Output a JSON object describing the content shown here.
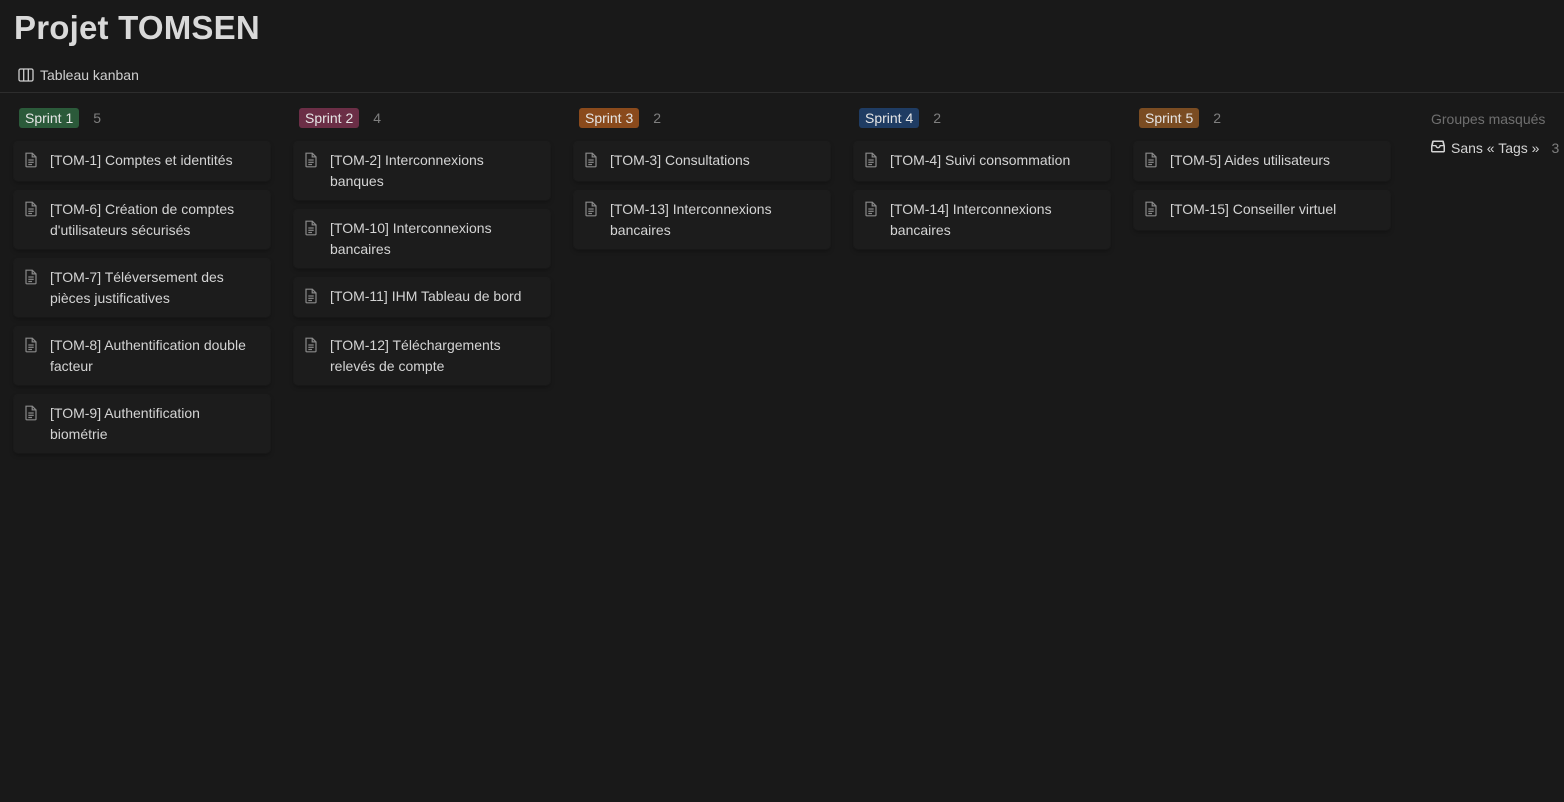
{
  "page": {
    "title": "Projet TOMSEN",
    "view_label": "Tableau kanban",
    "view_icon": "board-columns-icon"
  },
  "columns": [
    {
      "tag": "Sprint 1",
      "tag_color": "#2b5a3a",
      "count": "5",
      "cards": [
        "[TOM-1] Comptes et identités",
        "[TOM-6] Création de comptes d'utilisateurs sécurisés",
        "[TOM-7] Téléversement des pièces justificatives",
        "[TOM-8] Authentification double facteur",
        "[TOM-9] Authentification biométrie"
      ]
    },
    {
      "tag": "Sprint 2",
      "tag_color": "#6b2e46",
      "count": "4",
      "cards": [
        "[TOM-2] Interconnexions banques",
        "[TOM-10] Interconnexions bancaires",
        "[TOM-11] IHM Tableau de bord",
        "[TOM-12] Téléchargements relevés de compte"
      ]
    },
    {
      "tag": "Sprint 3",
      "tag_color": "#8a4a1c",
      "count": "2",
      "cards": [
        "[TOM-3] Consultations",
        "[TOM-13] Interconnexions bancaires"
      ]
    },
    {
      "tag": "Sprint 4",
      "tag_color": "#1f3c63",
      "count": "2",
      "cards": [
        "[TOM-4] Suivi consommation",
        "[TOM-14] Interconnexions bancaires"
      ]
    },
    {
      "tag": "Sprint 5",
      "tag_color": "#7a4c22",
      "count": "2",
      "cards": [
        "[TOM-5] Aides utilisateurs",
        "[TOM-15] Conseiller virtuel"
      ]
    }
  ],
  "hidden_groups": {
    "label": "Groupes masqués",
    "item_label": "Sans « Tags »",
    "item_count": "3",
    "item_icon": "inbox-icon"
  }
}
